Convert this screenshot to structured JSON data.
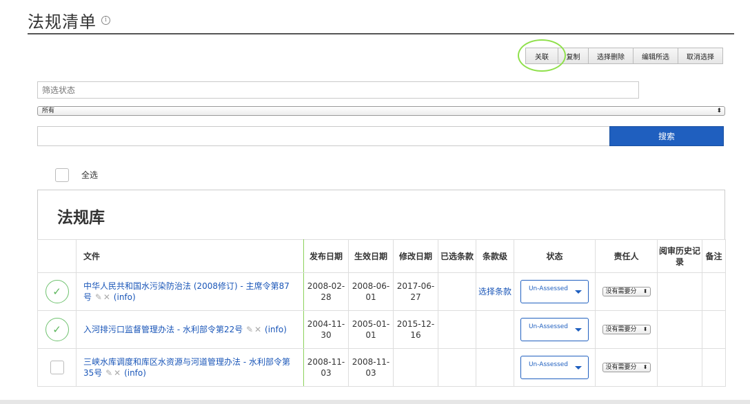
{
  "page": {
    "title": "法规清单",
    "info_icon": "i"
  },
  "toolbar": {
    "link_label": "关联",
    "copy_label": "复制",
    "delete_selected_label": "选择删除",
    "edit_selected_label": "编辑所选",
    "cancel_selection_label": "取消选择"
  },
  "filter": {
    "placeholder": "筛选状态",
    "select_value": "所有"
  },
  "search": {
    "button_label": "搜索",
    "value": ""
  },
  "select_all": {
    "label": "全选"
  },
  "library": {
    "title": "法规库"
  },
  "table": {
    "headers": {
      "file": "文件",
      "publish_date": "发布日期",
      "effective_date": "生效日期",
      "modified_date": "修改日期",
      "selected_clauses": "已选条款",
      "clause_level": "条款级",
      "status": "状态",
      "owner": "责任人",
      "review_history": "阅审历史记录",
      "notes": "备注"
    },
    "rows": [
      {
        "checked": true,
        "title": "中华人民共和国水污染防治法 (2008修订) - 主席令第87号",
        "info": "(info)",
        "publish_date": "2008-02-28",
        "effective_date": "2008-06-01",
        "modified_date": "2017-06-27",
        "selected_clauses": "",
        "clause_level": "选择条款",
        "status": "Un-Assessed",
        "owner": "没有需要分"
      },
      {
        "checked": true,
        "title": "入河排污口监督管理办法 - 水利部令第22号",
        "info": "(info)",
        "publish_date": "2004-11-30",
        "effective_date": "2005-01-01",
        "modified_date": "2015-12-16",
        "selected_clauses": "",
        "clause_level": "",
        "status": "Un-Assessed",
        "owner": "没有需要分"
      },
      {
        "checked": false,
        "title": "三峡水库调度和库区水资源与河道管理办法 - 水利部令第35号",
        "info": "(info)",
        "publish_date": "2008-11-03",
        "effective_date": "2008-11-03",
        "modified_date": "",
        "selected_clauses": "",
        "clause_level": "",
        "status": "Un-Assessed",
        "owner": "没有需要分"
      }
    ]
  }
}
